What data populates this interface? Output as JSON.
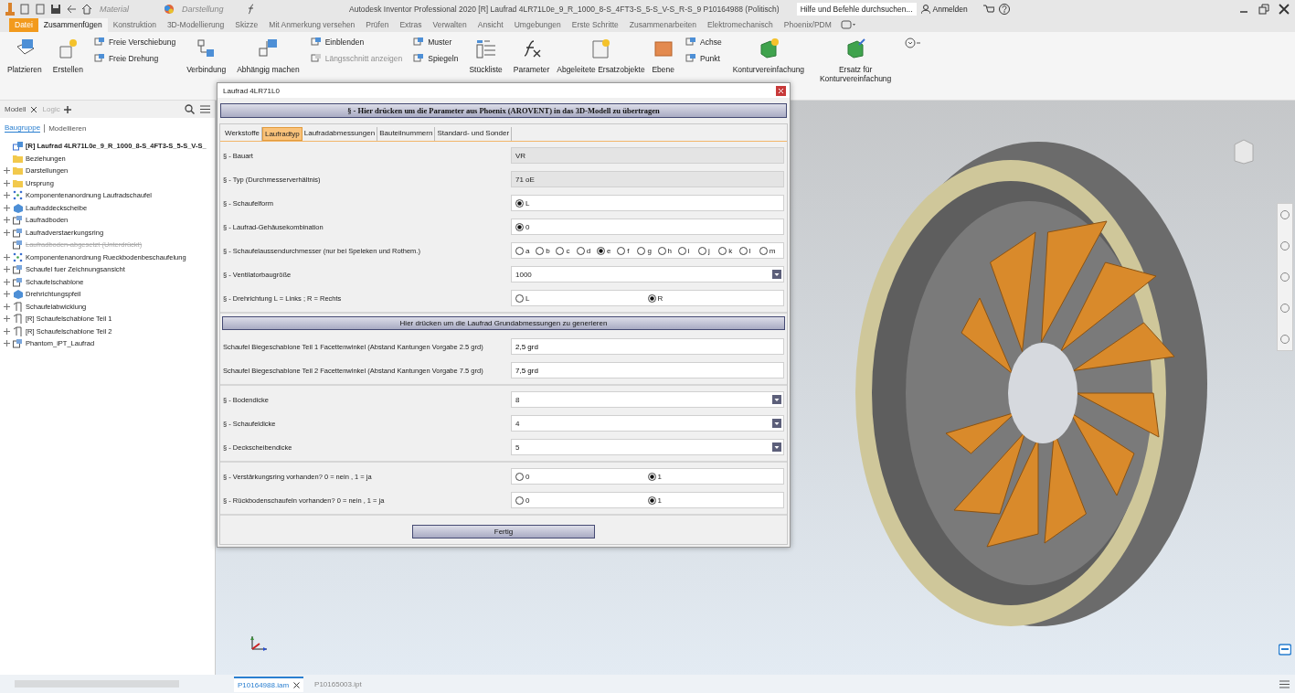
{
  "title_bar": {
    "material": "Material",
    "appearance": "Darstellung",
    "title": "Autodesk Inventor Professional 2020  [R] Laufrad 4LR71L0e_9_R_1000_8-S_4FT3-S_5-S_V-S_R-S_9 P10164988 (Politisch)",
    "search_placeholder": "Hilfe und Befehle durchsuchen...",
    "sign_in": "Anmelden"
  },
  "ribbon_tabs": [
    {
      "label": "Datei",
      "kind": "file",
      "selected": false
    },
    {
      "label": "Zusammenfügen",
      "kind": "tab",
      "selected": true
    },
    {
      "label": "Konstruktion",
      "kind": "tab",
      "selected": false
    },
    {
      "label": "3D-Modellierung",
      "kind": "tab",
      "selected": false
    },
    {
      "label": "Skizze",
      "kind": "tab",
      "selected": false
    },
    {
      "label": "Mit Anmerkung versehen",
      "kind": "tab",
      "selected": false
    },
    {
      "label": "Prüfen",
      "kind": "tab",
      "selected": false
    },
    {
      "label": "Extras",
      "kind": "tab",
      "selected": false
    },
    {
      "label": "Verwalten",
      "kind": "tab",
      "selected": false
    },
    {
      "label": "Ansicht",
      "kind": "tab",
      "selected": false
    },
    {
      "label": "Umgebungen",
      "kind": "tab",
      "selected": false
    },
    {
      "label": "Erste Schritte",
      "kind": "tab",
      "selected": false
    },
    {
      "label": "Zusammenarbeiten",
      "kind": "tab",
      "selected": false
    },
    {
      "label": "Elektromechanisch",
      "kind": "tab",
      "selected": false
    },
    {
      "label": "Phoenix/PDM",
      "kind": "tab",
      "selected": false
    }
  ],
  "ribbon": [
    {
      "kind": "large",
      "label": "Platzieren",
      "disabled": false
    },
    {
      "kind": "large",
      "label": "Erstellen",
      "disabled": false
    },
    {
      "kind": "stack",
      "items": [
        {
          "label": "Freie Verschiebung",
          "disabled": false
        },
        {
          "label": "Freie Drehung",
          "disabled": false
        }
      ]
    },
    {
      "kind": "large",
      "label": "Verbindung",
      "disabled": false
    },
    {
      "kind": "large",
      "label": "Abhängig machen",
      "disabled": false
    },
    {
      "kind": "stack",
      "items": [
        {
          "label": "Einblenden",
          "disabled": false
        },
        {
          "label": "Längsschnitt anzeigen",
          "disabled": true
        }
      ]
    },
    {
      "kind": "stack",
      "items": [
        {
          "label": "Muster",
          "disabled": false
        },
        {
          "label": "Spiegeln",
          "disabled": false
        }
      ]
    },
    {
      "kind": "large",
      "label": "Stückliste",
      "disabled": false
    },
    {
      "kind": "large",
      "label": "Parameter",
      "disabled": false
    },
    {
      "kind": "large",
      "label": "Abgeleitete Ersatzobjekte",
      "disabled": false
    },
    {
      "kind": "large",
      "label": "Ebene",
      "disabled": false
    },
    {
      "kind": "stack",
      "items": [
        {
          "label": "Achse",
          "disabled": false
        },
        {
          "label": "Punkt",
          "disabled": false
        }
      ]
    },
    {
      "kind": "large",
      "label": "Konturvereinfachung",
      "disabled": false
    },
    {
      "kind": "large",
      "label": "Ersatz für Konturvereinfachung",
      "disabled": false
    }
  ],
  "browser": {
    "tabs": [
      {
        "label": "Modell",
        "selected": true
      },
      {
        "label": "Logic",
        "selected": false
      }
    ],
    "modes": [
      {
        "label": "Baugruppe",
        "selected": true
      },
      {
        "label": "Modellieren",
        "selected": false
      }
    ],
    "tree": [
      {
        "label": "[R]  Laufrad 4LR71L0e_9_R_1000_8-S_4FT3-S_5-S_V-S_",
        "kind": "assembly",
        "expandable": false,
        "suppressed": false,
        "children": [
          {
            "label": "Beziehungen",
            "kind": "folder",
            "expandable": false,
            "suppressed": false
          },
          {
            "label": "Darstellungen",
            "kind": "folder",
            "expandable": true,
            "suppressed": false
          },
          {
            "label": "Ursprung",
            "kind": "folder",
            "expandable": true,
            "suppressed": false
          },
          {
            "label": "Komponentenanordnung Laufradschaufel",
            "kind": "pattern",
            "expandable": true,
            "suppressed": false
          },
          {
            "label": "Laufraddeckscheibe",
            "kind": "part",
            "expandable": true,
            "suppressed": false
          },
          {
            "label": "Laufradboden",
            "kind": "subassembly",
            "expandable": true,
            "suppressed": false
          },
          {
            "label": "Laufradverstaerkungsring",
            "kind": "subassembly",
            "expandable": true,
            "suppressed": false
          },
          {
            "label": "Laufradboden-abgesetzt (Unterdrückt)",
            "kind": "subassembly",
            "expandable": false,
            "suppressed": true
          },
          {
            "label": "Komponentenanordnung Rueckbodenbeschaufelung",
            "kind": "pattern",
            "expandable": true,
            "suppressed": false
          },
          {
            "label": "Schaufel fuer Zeichnungsansicht",
            "kind": "subassembly",
            "expandable": true,
            "suppressed": false
          },
          {
            "label": "Schaufelschablone",
            "kind": "subassembly",
            "expandable": true,
            "suppressed": false
          },
          {
            "label": "Drehrichtungspfeil",
            "kind": "part",
            "expandable": true,
            "suppressed": false
          },
          {
            "label": "Schaufelabwicklung",
            "kind": "sheet",
            "expandable": true,
            "suppressed": false
          },
          {
            "label": "[R]  Schaufelschablone Teil 1",
            "kind": "sheet",
            "expandable": true,
            "suppressed": false
          },
          {
            "label": "[R]  Schaufelschablone Teil 2",
            "kind": "sheet",
            "expandable": true,
            "suppressed": false
          },
          {
            "label": "Phantom_iPT_Laufrad",
            "kind": "subassembly",
            "expandable": true,
            "suppressed": false
          }
        ]
      }
    ]
  },
  "dialog": {
    "title": "Laufrad 4LR71L0",
    "top_button": "§ - Hier drücken um die Parameter aus Phoenix (AROVENT) in das 3D-Modell zu übertragen",
    "tabs": [
      {
        "label": "Werkstoffe",
        "selected": false
      },
      {
        "label": "Laufradtyp",
        "selected": true
      },
      {
        "label": "Laufradabmessungen",
        "selected": false
      },
      {
        "label": "Bauteilnummern",
        "selected": false
      },
      {
        "label": "Standard- und Sonder",
        "selected": false
      }
    ],
    "parts": [
      {
        "kind": "group",
        "rows": [
          {
            "label": "§ - Bauart",
            "kind": "readonly",
            "value": "VR"
          },
          {
            "label": "§ - Typ (Durchmesserverhältnis)",
            "kind": "readonly",
            "value": "71 oE"
          },
          {
            "label": "§ - Schaufelform",
            "kind": "radio",
            "options": [
              {
                "label": "L",
                "selected": true
              }
            ]
          },
          {
            "label": "§ - Laufrad-Gehäusekombination",
            "kind": "radio",
            "options": [
              {
                "label": "0",
                "selected": true
              }
            ]
          },
          {
            "label": "§ - Schaufelaussendurchmesser (nur bei Speleken und Rothem.)",
            "kind": "radio",
            "options": [
              {
                "label": "a",
                "selected": false
              },
              {
                "label": "b",
                "selected": false
              },
              {
                "label": "c",
                "selected": false
              },
              {
                "label": "d",
                "selected": false
              },
              {
                "label": "e",
                "selected": true
              },
              {
                "label": "f",
                "selected": false
              },
              {
                "label": "g",
                "selected": false
              },
              {
                "label": "h",
                "selected": false
              },
              {
                "label": "i",
                "selected": false
              },
              {
                "label": "j",
                "selected": false
              },
              {
                "label": "k",
                "selected": false
              },
              {
                "label": "l",
                "selected": false
              },
              {
                "label": "m",
                "selected": false
              }
            ]
          },
          {
            "label": "§ - Ventilatorbaugröße",
            "kind": "dropdown",
            "value": "1000"
          },
          {
            "label": "§ - Drehrichtung L = Links ; R = Rechts",
            "kind": "radio",
            "options": [
              {
                "label": "L",
                "selected": false
              },
              {
                "label": "R",
                "selected": true
              }
            ]
          }
        ]
      },
      {
        "kind": "button",
        "label": "Hier drücken um die Laufrad Grundabmessungen zu generieren"
      },
      {
        "kind": "group",
        "rows": [
          {
            "label": "Schaufel Biegeschablone Teil 1 Facettenwinkel (Abstand Kantungen Vorgabe 2.5 grd)",
            "kind": "text",
            "value": "2,5 grd"
          },
          {
            "label": "Schaufel Biegeschablone Teil 2 Facettenwinkel (Abstand Kantungen Vorgabe 7.5 grd)",
            "kind": "text",
            "value": "7,5 grd"
          }
        ]
      },
      {
        "kind": "group",
        "rows": [
          {
            "label": "§ - Bodendicke",
            "kind": "dropdown",
            "value": "8"
          },
          {
            "label": "§ - Schaufeldicke",
            "kind": "dropdown",
            "value": "4"
          },
          {
            "label": "§ - Deckscheibendicke",
            "kind": "dropdown",
            "value": "5"
          }
        ]
      },
      {
        "kind": "group",
        "rows": [
          {
            "label": "§ - Verstärkungsring vorhanden? 0 = nein , 1 = ja",
            "kind": "radio",
            "options": [
              {
                "label": "0",
                "selected": false
              },
              {
                "label": "1",
                "selected": true
              }
            ]
          },
          {
            "label": "§ - Rückbodenschaufeln vorhanden? 0 = nein , 1 = ja",
            "kind": "radio",
            "options": [
              {
                "label": "0",
                "selected": false
              },
              {
                "label": "1",
                "selected": true
              }
            ]
          }
        ]
      }
    ],
    "done_button": "Fertig"
  },
  "doc_tabs": [
    {
      "label": "P10164988.iam",
      "selected": true,
      "closable": true
    },
    {
      "label": "P10165003.ipt",
      "selected": false,
      "closable": false
    }
  ]
}
